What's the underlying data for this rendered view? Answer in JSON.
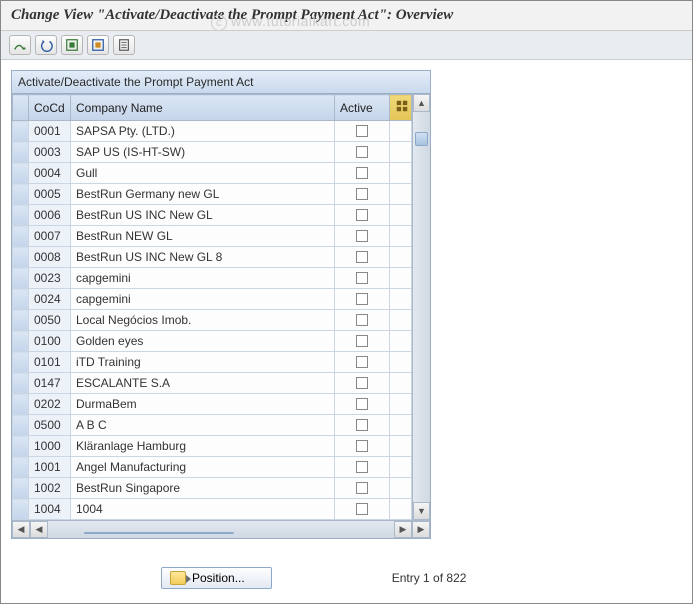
{
  "header": {
    "title": "Change View \"Activate/Deactivate the Prompt Payment Act\": Overview",
    "watermark": "www.tutorialkart.com"
  },
  "panel": {
    "title": "Activate/Deactivate the Prompt Payment Act"
  },
  "columns": {
    "cocd": "CoCd",
    "name": "Company Name",
    "active": "Active"
  },
  "rows": [
    {
      "cocd": "0001",
      "name": "SAPSA Pty. (LTD.)",
      "active": false
    },
    {
      "cocd": "0003",
      "name": "SAP US (IS-HT-SW)",
      "active": false
    },
    {
      "cocd": "0004",
      "name": "Gull",
      "active": false
    },
    {
      "cocd": "0005",
      "name": "BestRun Germany new GL",
      "active": false
    },
    {
      "cocd": "0006",
      "name": "BestRun US INC New GL",
      "active": false
    },
    {
      "cocd": "0007",
      "name": "BestRun NEW GL",
      "active": false
    },
    {
      "cocd": "0008",
      "name": "BestRun US INC New GL 8",
      "active": false
    },
    {
      "cocd": "0023",
      "name": "capgemini",
      "active": false
    },
    {
      "cocd": "0024",
      "name": "capgemini",
      "active": false
    },
    {
      "cocd": "0050",
      "name": "Local Negócios Imob.",
      "active": false
    },
    {
      "cocd": "0100",
      "name": "Golden eyes",
      "active": false
    },
    {
      "cocd": "0101",
      "name": "iTD Training",
      "active": false
    },
    {
      "cocd": "0147",
      "name": "ESCALANTE S.A",
      "active": false
    },
    {
      "cocd": "0202",
      "name": "DurmaBem",
      "active": false
    },
    {
      "cocd": "0500",
      "name": "A B C",
      "active": false
    },
    {
      "cocd": "1000",
      "name": "Kläranlage Hamburg",
      "active": false
    },
    {
      "cocd": "1001",
      "name": "Angel Manufacturing",
      "active": false
    },
    {
      "cocd": "1002",
      "name": "BestRun Singapore",
      "active": false
    },
    {
      "cocd": "1004",
      "name": "1004",
      "active": false
    }
  ],
  "footer": {
    "position_label": "Position...",
    "entry_info": "Entry 1 of 822"
  }
}
